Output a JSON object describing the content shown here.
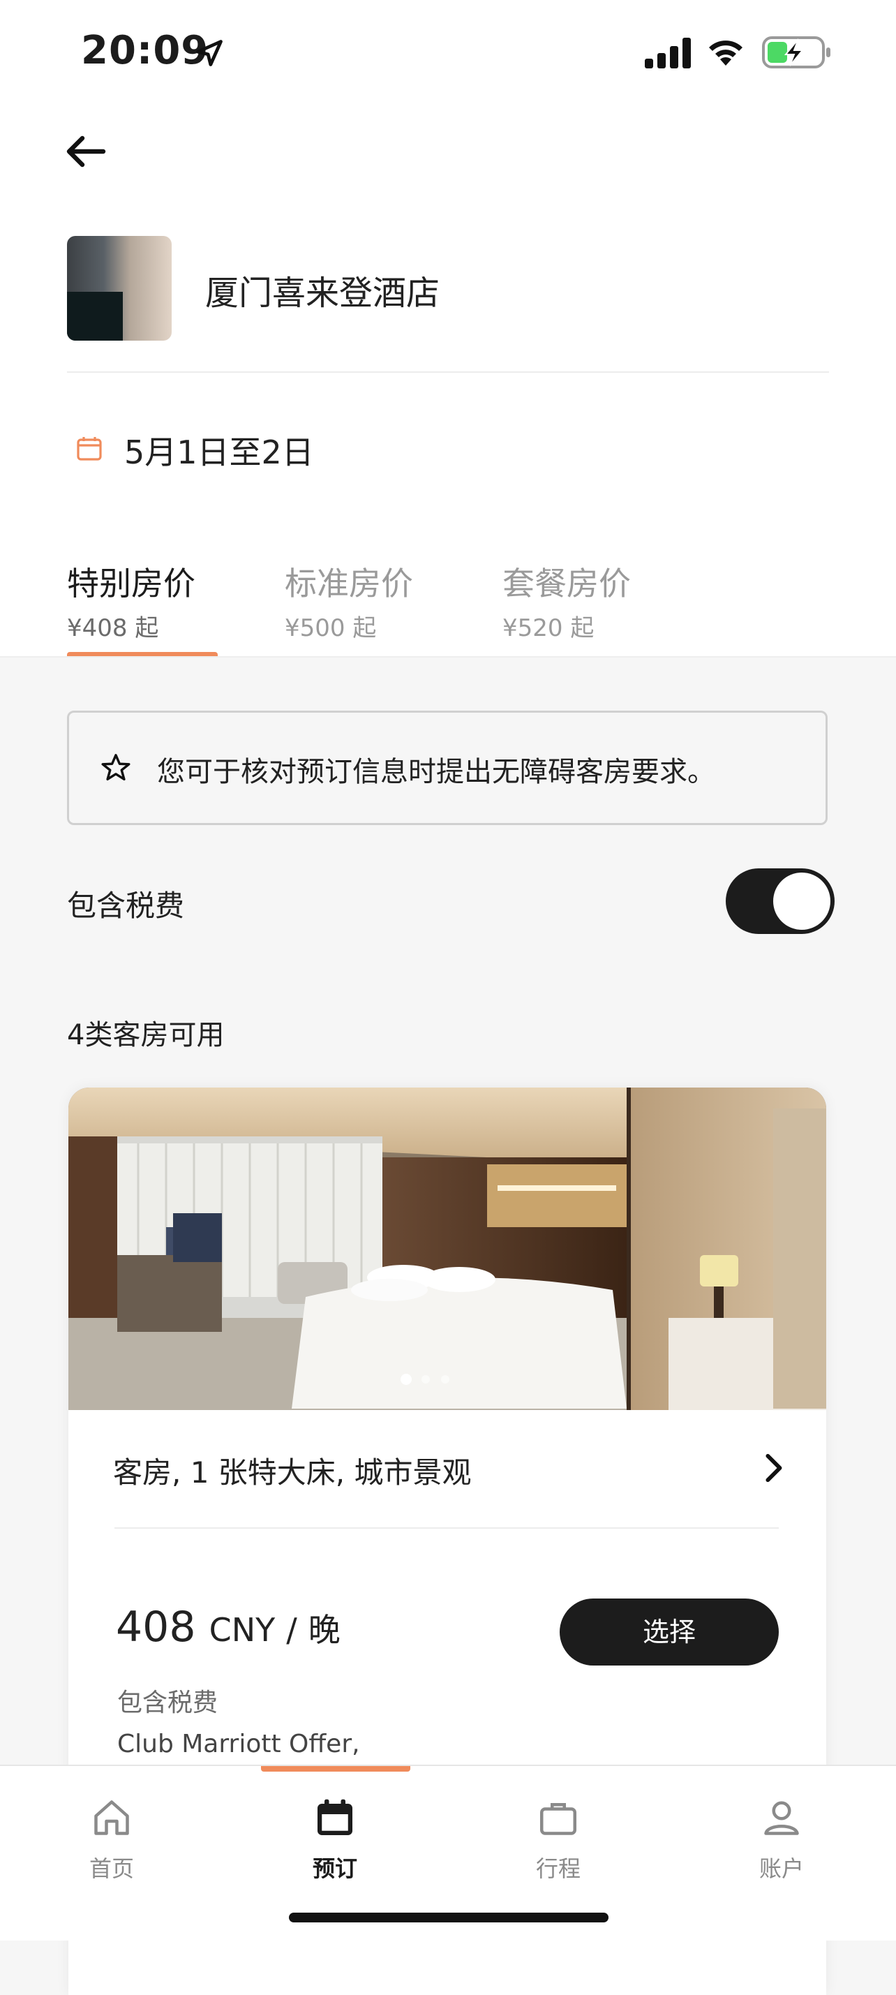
{
  "status_bar": {
    "time": "20:09"
  },
  "hotel": {
    "name": "厦门喜来登酒店"
  },
  "stay": {
    "dates": "5月1日至2日"
  },
  "rate_tabs": [
    {
      "label": "特别房价",
      "price": "¥408 起",
      "active": true
    },
    {
      "label": "标准房价",
      "price": "¥500 起",
      "active": false
    },
    {
      "label": "套餐房价",
      "price": "¥520 起",
      "active": false
    }
  ],
  "notice": {
    "text": "您可于核对预订信息时提出无障碍客房要求。"
  },
  "tax_toggle": {
    "label": "包含税费",
    "on": true
  },
  "rooms": {
    "count_label": "4类客房可用",
    "items": [
      {
        "title": "客房, 1 张特大床, 城市景观",
        "price": "408",
        "currency": "CNY",
        "separator": "/",
        "per": "晚",
        "select_label": "选择",
        "tax_note": "包含税费",
        "offer": "Club Marriott Offer,",
        "photo_page": 1,
        "photo_pages": 3
      }
    ]
  },
  "bottom_nav": [
    {
      "label": "首页",
      "icon": "home-icon",
      "active": false
    },
    {
      "label": "预订",
      "icon": "calendar-icon",
      "active": true
    },
    {
      "label": "行程",
      "icon": "briefcase-icon",
      "active": false
    },
    {
      "label": "账户",
      "icon": "person-icon",
      "active": false
    }
  ],
  "colors": {
    "accent": "#f08b5b",
    "dark": "#1c1c1c"
  }
}
